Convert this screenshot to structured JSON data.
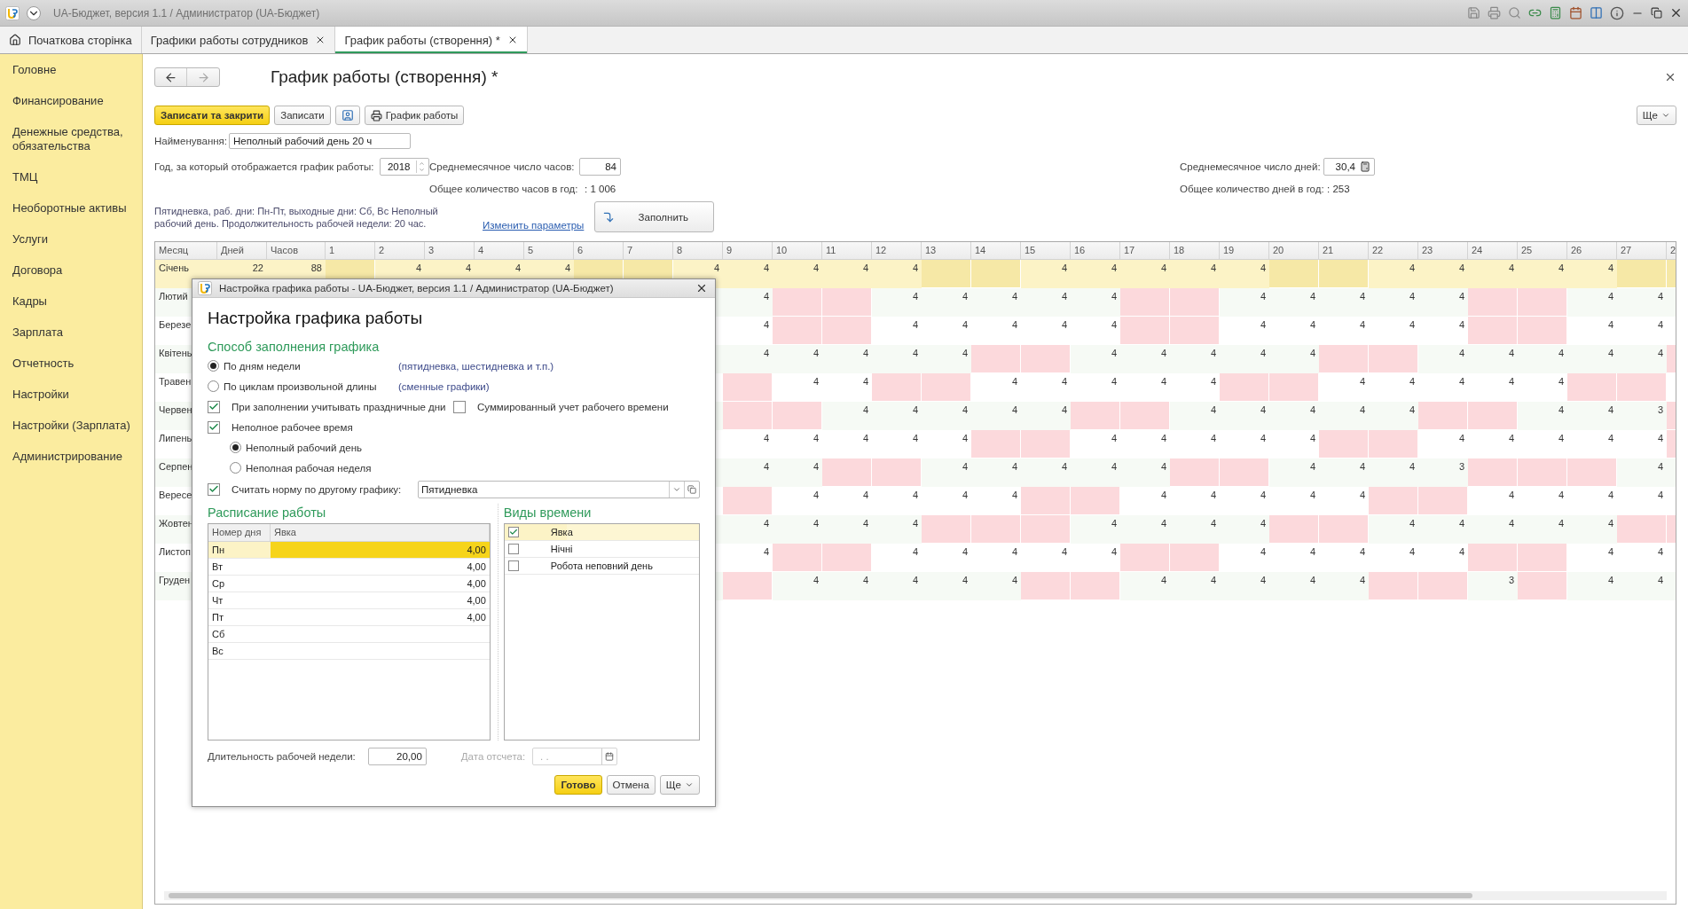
{
  "app_title": "UA-Бюджет, версия 1.1 / Администратор  (UA-Бюджет)",
  "tabs": [
    {
      "label": "Початкова сторінка",
      "kind": "home",
      "selected": false
    },
    {
      "label": "Графики работы сотрудников",
      "kind": "closable",
      "selected": false
    },
    {
      "label": "График работы (створення) *",
      "kind": "closable",
      "selected": true
    }
  ],
  "sidebar": {
    "items": [
      "Головне",
      "Финансирование",
      "Денежные средства, обязательства",
      "ТМЦ",
      "Необоротные активы",
      "Услуги",
      "Договора",
      "Кадры",
      "Зарплата",
      "Отчетность",
      "Настройки",
      "Настройки (Зарплата)",
      "Администрирование"
    ]
  },
  "form": {
    "title": "График работы (створення) *",
    "toolbar": [
      {
        "kind": "primary",
        "label": "Записати та закрити"
      },
      {
        "kind": "plain",
        "label": "Записати"
      },
      {
        "kind": "icon"
      },
      {
        "kind": "print",
        "label": "График работы"
      }
    ],
    "more": "Ще",
    "name_label": "Найменування:",
    "name_value": "Неполный рабочий день 20 ч",
    "year_label": "Год, за который отображается график работы:",
    "year_value": "2018",
    "avg_hours_label": "Среднемесячное число часов:",
    "avg_hours_value": "84",
    "total_hours_label": "Общее количество часов в год:",
    "total_hours_value": ": 1 006",
    "avg_days_label": "Среднемесячное число дней:",
    "avg_days_value": "30,4",
    "total_days_label": "Общее количество дней в год:",
    "total_days_value": ": 253",
    "description": "Пятидневка, раб. дни: Пн-Пт, выходные дни: Сб, Вс Неполный рабочий день. Продолжительность рабочей недели: 20 час.",
    "change_link": "Изменить параметры",
    "fill_button": "Заполнить"
  },
  "grid": {
    "columns": [
      "Месяц",
      "Дней",
      "Часов",
      "1",
      "2",
      "3",
      "4",
      "5",
      "6",
      "7",
      "8",
      "9",
      "10",
      "11",
      "12",
      "13",
      "14",
      "15",
      "16",
      "17",
      "18",
      "19",
      "20",
      "21",
      "22",
      "23",
      "24",
      "25",
      "26",
      "27",
      "2"
    ],
    "rows": [
      {
        "month": "Січень",
        "days": "22",
        "hours": "88",
        "selected": true,
        "early_cells": [
          {
            "off": true
          },
          {
            "hours": "4",
            "off": false
          },
          {
            "hours": "4",
            "off": false
          },
          {
            "hours": "4",
            "off": false
          },
          {
            "hours": "4",
            "off": false
          },
          {
            "off": true
          },
          {
            "off": true
          },
          {
            "hours": "4",
            "off": false
          }
        ],
        "cells": [
          {
            "hours": "4",
            "off": false
          },
          {
            "hours": "4",
            "off": false
          },
          {
            "hours": "4",
            "off": false
          },
          {
            "hours": "4",
            "off": false
          },
          {
            "off": true
          },
          {
            "off": true
          },
          {
            "hours": "4",
            "off": false
          },
          {
            "hours": "4",
            "off": false
          },
          {
            "hours": "4",
            "off": false
          },
          {
            "hours": "4",
            "off": false
          },
          {
            "hours": "4",
            "off": false
          },
          {
            "off": true
          },
          {
            "off": true
          },
          {
            "hours": "4",
            "off": false
          },
          {
            "hours": "4",
            "off": false
          },
          {
            "hours": "4",
            "off": false
          },
          {
            "hours": "4",
            "off": false
          },
          {
            "hours": "4",
            "off": false
          },
          {
            "off": true
          },
          {
            "off": true
          }
        ]
      },
      {
        "month": "Лютий",
        "selected": false,
        "cells": [
          {
            "hours": "4",
            "off": false
          },
          {
            "off": true
          },
          {
            "off": true
          },
          {
            "hours": "4",
            "off": false
          },
          {
            "hours": "4",
            "off": false
          },
          {
            "hours": "4",
            "off": false
          },
          {
            "hours": "4",
            "off": false
          },
          {
            "hours": "4",
            "off": false
          },
          {
            "off": true
          },
          {
            "off": true
          },
          {
            "hours": "4",
            "off": false
          },
          {
            "hours": "4",
            "off": false
          },
          {
            "hours": "4",
            "off": false
          },
          {
            "hours": "4",
            "off": false
          },
          {
            "hours": "4",
            "off": false
          },
          {
            "off": true
          },
          {
            "off": true
          },
          {
            "hours": "4",
            "off": false
          },
          {
            "hours": "4",
            "off": false
          },
          {
            "off": false
          }
        ]
      },
      {
        "month": "Березе",
        "selected": false,
        "cells": [
          {
            "hours": "4",
            "off": false
          },
          {
            "off": true
          },
          {
            "off": true
          },
          {
            "hours": "4",
            "off": false
          },
          {
            "hours": "4",
            "off": false
          },
          {
            "hours": "4",
            "off": false
          },
          {
            "hours": "4",
            "off": false
          },
          {
            "hours": "4",
            "off": false
          },
          {
            "off": true
          },
          {
            "off": true
          },
          {
            "hours": "4",
            "off": false
          },
          {
            "hours": "4",
            "off": false
          },
          {
            "hours": "4",
            "off": false
          },
          {
            "hours": "4",
            "off": false
          },
          {
            "hours": "4",
            "off": false
          },
          {
            "off": true
          },
          {
            "off": true
          },
          {
            "hours": "4",
            "off": false
          },
          {
            "hours": "4",
            "off": false
          },
          {
            "off": false
          }
        ]
      },
      {
        "month": "Квітень",
        "selected": false,
        "cells": [
          {
            "hours": "4",
            "off": false
          },
          {
            "hours": "4",
            "off": false
          },
          {
            "hours": "4",
            "off": false
          },
          {
            "hours": "4",
            "off": false
          },
          {
            "hours": "4",
            "off": false
          },
          {
            "off": true
          },
          {
            "off": true
          },
          {
            "hours": "4",
            "off": false
          },
          {
            "hours": "4",
            "off": false
          },
          {
            "hours": "4",
            "off": false
          },
          {
            "hours": "4",
            "off": false
          },
          {
            "hours": "4",
            "off": false
          },
          {
            "off": true
          },
          {
            "off": true
          },
          {
            "hours": "4",
            "off": false
          },
          {
            "hours": "4",
            "off": false
          },
          {
            "hours": "4",
            "off": false
          },
          {
            "hours": "4",
            "off": false
          },
          {
            "hours": "4",
            "off": false
          },
          {
            "off": true
          }
        ]
      },
      {
        "month": "Травен",
        "selected": false,
        "cells": [
          {
            "off": true
          },
          {
            "hours": "4",
            "off": false
          },
          {
            "hours": "4",
            "off": false
          },
          {
            "off": true
          },
          {
            "off": true
          },
          {
            "hours": "4",
            "off": false
          },
          {
            "hours": "4",
            "off": false
          },
          {
            "hours": "4",
            "off": false
          },
          {
            "hours": "4",
            "off": false
          },
          {
            "hours": "4",
            "off": false
          },
          {
            "off": true
          },
          {
            "off": true
          },
          {
            "hours": "4",
            "off": false
          },
          {
            "hours": "4",
            "off": false
          },
          {
            "hours": "4",
            "off": false
          },
          {
            "hours": "4",
            "off": false
          },
          {
            "hours": "4",
            "off": false
          },
          {
            "off": true
          },
          {
            "off": true
          },
          {
            "off": false
          }
        ]
      },
      {
        "month": "Червен",
        "selected": false,
        "cells": [
          {
            "off": true
          },
          {
            "off": true
          },
          {
            "hours": "4",
            "off": false
          },
          {
            "hours": "4",
            "off": false
          },
          {
            "hours": "4",
            "off": false
          },
          {
            "hours": "4",
            "off": false
          },
          {
            "hours": "4",
            "off": false
          },
          {
            "off": true
          },
          {
            "off": true
          },
          {
            "hours": "4",
            "off": false
          },
          {
            "hours": "4",
            "off": false
          },
          {
            "hours": "4",
            "off": false
          },
          {
            "hours": "4",
            "off": false
          },
          {
            "hours": "4",
            "off": false
          },
          {
            "off": true
          },
          {
            "off": true
          },
          {
            "hours": "4",
            "off": false
          },
          {
            "hours": "4",
            "off": false
          },
          {
            "hours": "3",
            "off": false
          },
          {
            "off": true
          }
        ]
      },
      {
        "month": "Липень",
        "selected": false,
        "cells": [
          {
            "hours": "4",
            "off": false
          },
          {
            "hours": "4",
            "off": false
          },
          {
            "hours": "4",
            "off": false
          },
          {
            "hours": "4",
            "off": false
          },
          {
            "hours": "4",
            "off": false
          },
          {
            "off": true
          },
          {
            "off": true
          },
          {
            "hours": "4",
            "off": false
          },
          {
            "hours": "4",
            "off": false
          },
          {
            "hours": "4",
            "off": false
          },
          {
            "hours": "4",
            "off": false
          },
          {
            "hours": "4",
            "off": false
          },
          {
            "off": true
          },
          {
            "off": true
          },
          {
            "hours": "4",
            "off": false
          },
          {
            "hours": "4",
            "off": false
          },
          {
            "hours": "4",
            "off": false
          },
          {
            "hours": "4",
            "off": false
          },
          {
            "hours": "4",
            "off": false
          },
          {
            "off": true
          }
        ]
      },
      {
        "month": "Серпен",
        "selected": false,
        "cells": [
          {
            "hours": "4",
            "off": false
          },
          {
            "hours": "4",
            "off": false
          },
          {
            "off": true
          },
          {
            "off": true
          },
          {
            "hours": "4",
            "off": false
          },
          {
            "hours": "4",
            "off": false
          },
          {
            "hours": "4",
            "off": false
          },
          {
            "hours": "4",
            "off": false
          },
          {
            "hours": "4",
            "off": false
          },
          {
            "off": true
          },
          {
            "off": true
          },
          {
            "hours": "4",
            "off": false
          },
          {
            "hours": "4",
            "off": false
          },
          {
            "hours": "4",
            "off": false
          },
          {
            "hours": "3",
            "off": false
          },
          {
            "off": true
          },
          {
            "off": true
          },
          {
            "off": true
          },
          {
            "hours": "4",
            "off": false
          },
          {
            "off": false
          }
        ]
      },
      {
        "month": "Вересе",
        "selected": false,
        "cells": [
          {
            "off": true
          },
          {
            "hours": "4",
            "off": false
          },
          {
            "hours": "4",
            "off": false
          },
          {
            "hours": "4",
            "off": false
          },
          {
            "hours": "4",
            "off": false
          },
          {
            "hours": "4",
            "off": false
          },
          {
            "off": true
          },
          {
            "off": true
          },
          {
            "hours": "4",
            "off": false
          },
          {
            "hours": "4",
            "off": false
          },
          {
            "hours": "4",
            "off": false
          },
          {
            "hours": "4",
            "off": false
          },
          {
            "hours": "4",
            "off": false
          },
          {
            "off": true
          },
          {
            "off": true
          },
          {
            "hours": "4",
            "off": false
          },
          {
            "hours": "4",
            "off": false
          },
          {
            "hours": "4",
            "off": false
          },
          {
            "hours": "4",
            "off": false
          },
          {
            "off": false
          }
        ]
      },
      {
        "month": "Жовтен",
        "selected": false,
        "cells": [
          {
            "hours": "4",
            "off": false
          },
          {
            "hours": "4",
            "off": false
          },
          {
            "hours": "4",
            "off": false
          },
          {
            "hours": "4",
            "off": false
          },
          {
            "off": true
          },
          {
            "off": true
          },
          {
            "off": true
          },
          {
            "hours": "4",
            "off": false
          },
          {
            "hours": "4",
            "off": false
          },
          {
            "hours": "4",
            "off": false
          },
          {
            "hours": "4",
            "off": false
          },
          {
            "off": true
          },
          {
            "off": true
          },
          {
            "hours": "4",
            "off": false
          },
          {
            "hours": "4",
            "off": false
          },
          {
            "hours": "4",
            "off": false
          },
          {
            "hours": "4",
            "off": false
          },
          {
            "hours": "4",
            "off": false
          },
          {
            "off": true
          },
          {
            "off": true
          }
        ]
      },
      {
        "month": "Листоп",
        "selected": false,
        "cells": [
          {
            "hours": "4",
            "off": false
          },
          {
            "off": true
          },
          {
            "off": true
          },
          {
            "hours": "4",
            "off": false
          },
          {
            "hours": "4",
            "off": false
          },
          {
            "hours": "4",
            "off": false
          },
          {
            "hours": "4",
            "off": false
          },
          {
            "hours": "4",
            "off": false
          },
          {
            "off": true
          },
          {
            "off": true
          },
          {
            "hours": "4",
            "off": false
          },
          {
            "hours": "4",
            "off": false
          },
          {
            "hours": "4",
            "off": false
          },
          {
            "hours": "4",
            "off": false
          },
          {
            "hours": "4",
            "off": false
          },
          {
            "off": true
          },
          {
            "off": true
          },
          {
            "hours": "4",
            "off": false
          },
          {
            "hours": "4",
            "off": false
          },
          {
            "off": false
          }
        ]
      },
      {
        "month": "Груден",
        "selected": false,
        "cells": [
          {
            "off": true
          },
          {
            "hours": "4",
            "off": false
          },
          {
            "hours": "4",
            "off": false
          },
          {
            "hours": "4",
            "off": false
          },
          {
            "hours": "4",
            "off": false
          },
          {
            "hours": "4",
            "off": false
          },
          {
            "off": true
          },
          {
            "off": true
          },
          {
            "hours": "4",
            "off": false
          },
          {
            "hours": "4",
            "off": false
          },
          {
            "hours": "4",
            "off": false
          },
          {
            "hours": "4",
            "off": false
          },
          {
            "hours": "4",
            "off": false
          },
          {
            "off": true
          },
          {
            "off": true
          },
          {
            "hours": "3",
            "off": false
          },
          {
            "off": true
          },
          {
            "hours": "4",
            "off": false
          },
          {
            "hours": "4",
            "off": false
          },
          {
            "off": false
          }
        ]
      }
    ]
  },
  "dialog": {
    "window_title": "Настройка графика работы - UA-Бюджет, версия 1.1 / Администратор  (UA-Бюджет)",
    "heading": "Настройка графика работы",
    "fill_section": "Способ заполнения графика",
    "fill_methods": [
      {
        "label": "По дням недели",
        "hint": "(пятидневка, шестидневка и т.п.)",
        "selected": true
      },
      {
        "label": "По циклам произвольной длины",
        "hint": "(сменные графики)",
        "selected": false
      }
    ],
    "options": [
      {
        "label": "При заполнении учитывать праздничные дни",
        "checked": true
      },
      {
        "label": "Суммированный учет рабочего времени",
        "checked": false
      }
    ],
    "part_time": {
      "label": "Неполное рабочее время",
      "checked": true,
      "modes": [
        {
          "label": "Неполный рабочий день",
          "selected": true
        },
        {
          "label": "Неполная рабочая неделя",
          "selected": false
        }
      ]
    },
    "norm": {
      "label": "Считать норму по другому графику:",
      "checked": true,
      "value": "Пятидневка"
    },
    "schedule": {
      "title": "Расписание работы",
      "columns": [
        "Номер дня",
        "Явка"
      ],
      "rows": [
        {
          "day": "Пн",
          "value": "4,00",
          "selected": true
        },
        {
          "day": "Вт",
          "value": "4,00",
          "selected": false
        },
        {
          "day": "Ср",
          "value": "4,00",
          "selected": false
        },
        {
          "day": "Чт",
          "value": "4,00",
          "selected": false
        },
        {
          "day": "Пт",
          "value": "4,00",
          "selected": false
        },
        {
          "day": "Сб",
          "selected": false
        },
        {
          "day": "Вс",
          "selected": false
        }
      ]
    },
    "time_types": {
      "title": "Виды времени",
      "items": [
        {
          "label": "Явка",
          "checked": true,
          "selected": true
        },
        {
          "label": "Нічні",
          "checked": false,
          "selected": false
        },
        {
          "label": "Робота неповний день",
          "checked": false,
          "selected": false
        }
      ]
    },
    "week_length": {
      "label": "Длительность рабочей недели:",
      "value": "20,00"
    },
    "ref_date": {
      "label": "Дата отсчета:",
      "placeholder": ". .",
      "disabled": true
    },
    "buttons": [
      {
        "kind": "primary",
        "label": "Готово"
      },
      {
        "kind": "plain",
        "label": "Отмена"
      },
      {
        "kind": "menu",
        "label": "Ще"
      }
    ]
  }
}
